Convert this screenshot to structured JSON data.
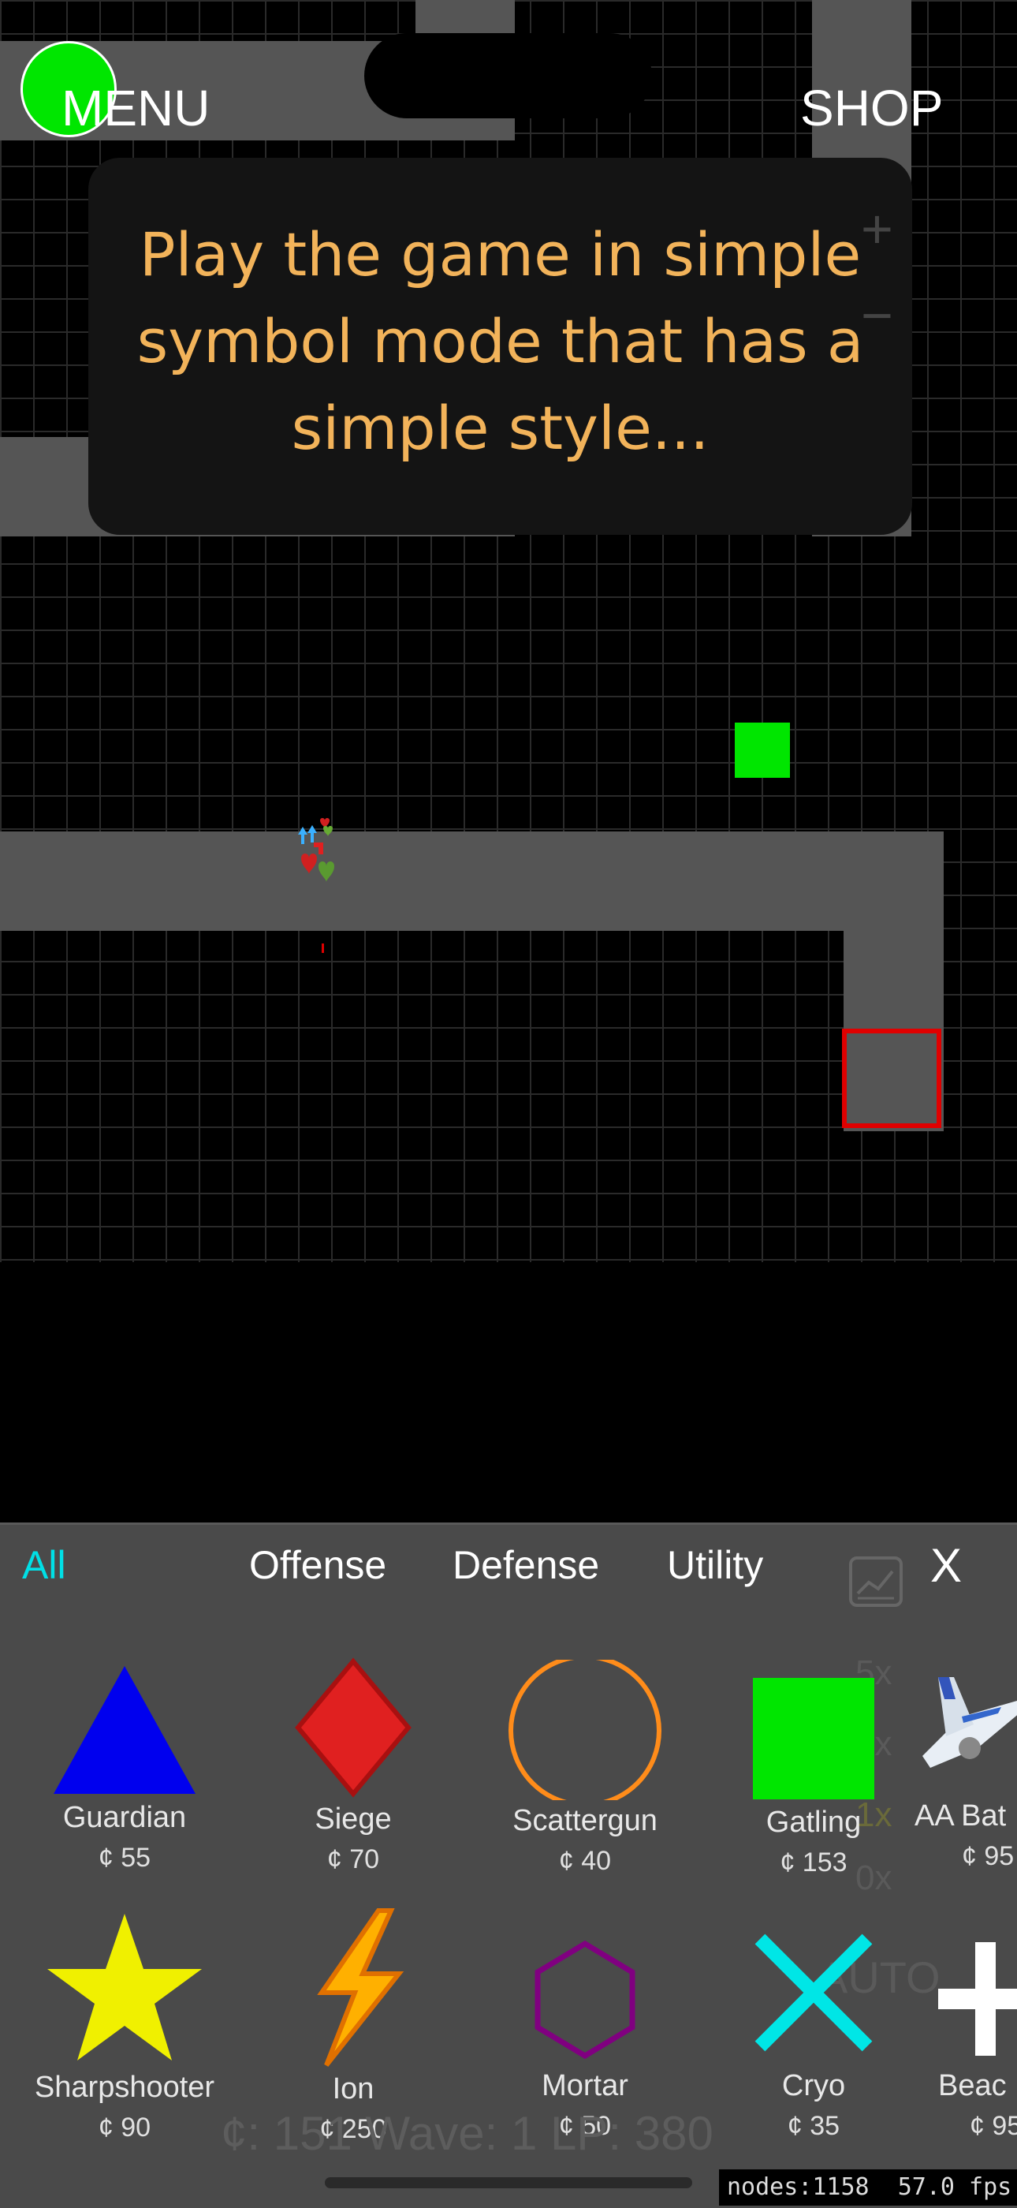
{
  "hud": {
    "menu_label": "MENU",
    "shop_label": "SHOP",
    "zoom_in": "+",
    "zoom_out": "−"
  },
  "tip": {
    "text": "Play the game in simple symbol mode that has a simple style..."
  },
  "build_panel": {
    "tabs": [
      "All",
      "Offense",
      "Defense",
      "Utility"
    ],
    "active_tab": "All",
    "close_label": "X",
    "stats_icon": "chart-icon",
    "towers": [
      {
        "name": "Guardian",
        "cost": "¢ 55",
        "icon": "triangle",
        "color": "#0000ee"
      },
      {
        "name": "Siege",
        "cost": "¢ 70",
        "icon": "diamond",
        "color": "#e02020"
      },
      {
        "name": "Scattergun",
        "cost": "¢ 40",
        "icon": "circle",
        "color": "#ff8c1a"
      },
      {
        "name": "Gatling",
        "cost": "¢ 153",
        "icon": "square",
        "color": "#00e600"
      },
      {
        "name": "AA Bat",
        "cost": "¢ 95",
        "icon": "airplane",
        "color": "#ffffff"
      },
      {
        "name": "Sharpshooter",
        "cost": "¢ 90",
        "icon": "star",
        "color": "#f0f000"
      },
      {
        "name": "Ion",
        "cost": "¢ 250",
        "icon": "lightning",
        "color": "#ffb000"
      },
      {
        "name": "Mortar",
        "cost": "¢ 50",
        "icon": "hexagon",
        "color": "#800080"
      },
      {
        "name": "Cryo",
        "cost": "¢ 35",
        "icon": "x-cross",
        "color": "#00e6e6"
      },
      {
        "name": "Beac",
        "cost": "¢ 95",
        "icon": "plus",
        "color": "#ffffff"
      }
    ],
    "speeds": [
      "5x",
      "2x",
      "1x",
      "0x",
      "AUTO"
    ]
  },
  "status": {
    "text": "¢: 151    Wave: 1    LP: 380"
  },
  "debug": {
    "text": "nodes:1158  57.0 fps"
  }
}
